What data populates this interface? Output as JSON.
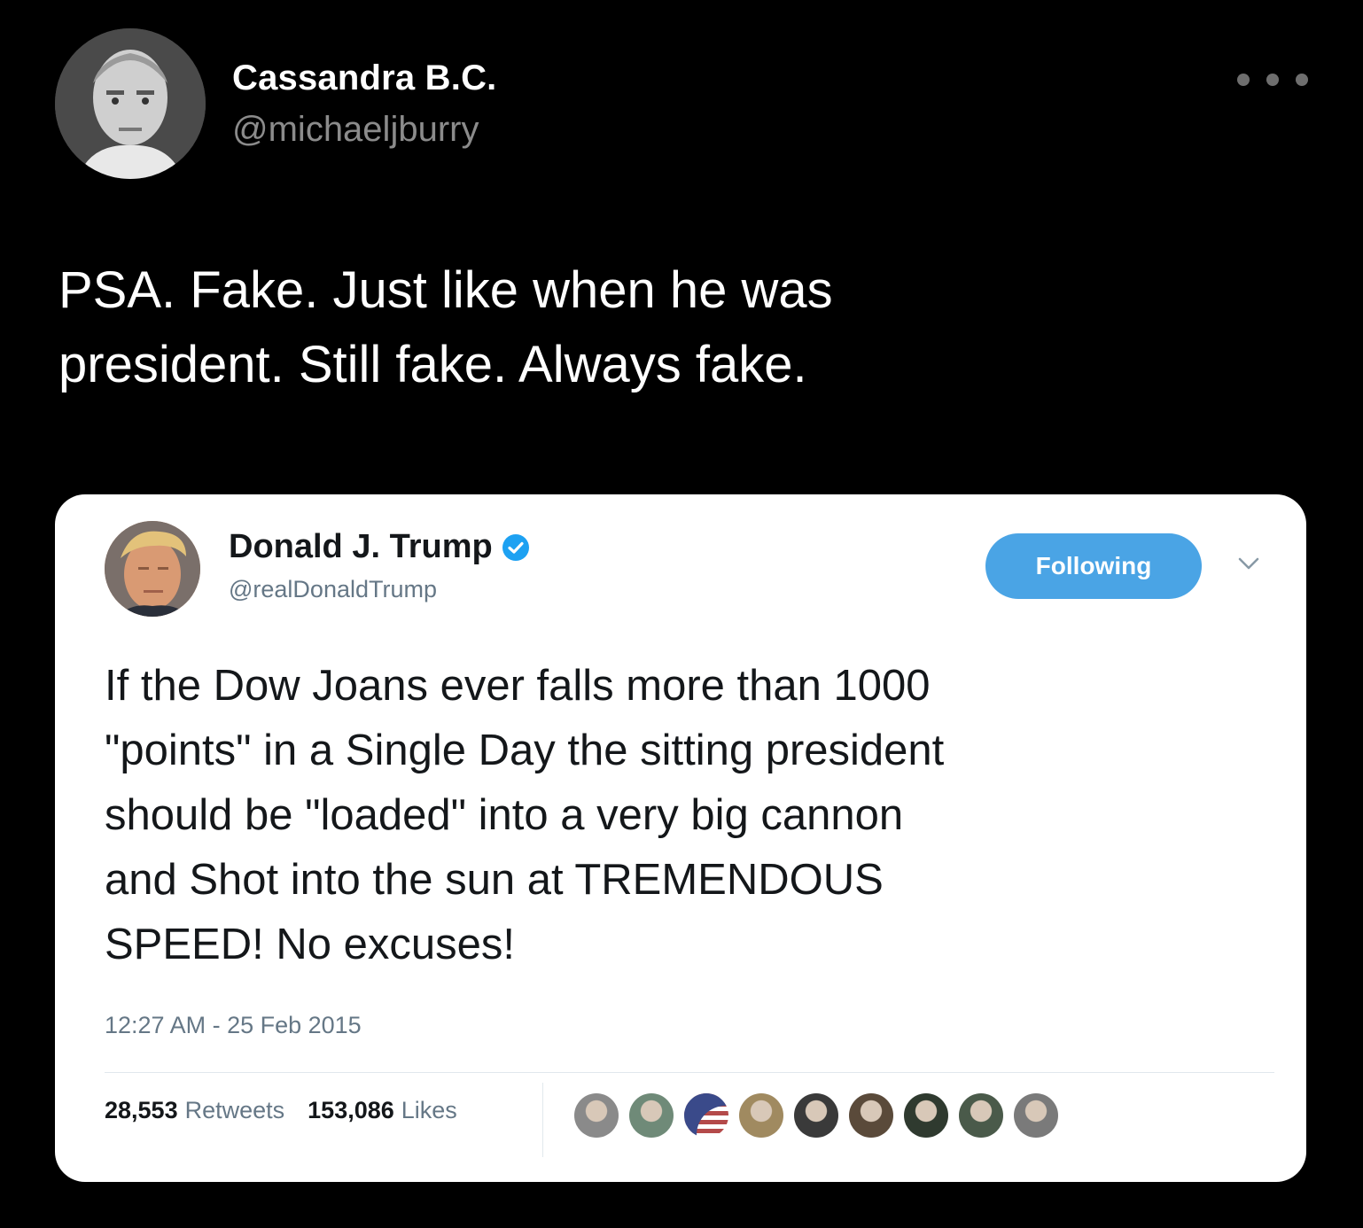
{
  "outer_tweet": {
    "display_name": "Cassandra B.C.",
    "handle": "@michaeljburry",
    "text_lines": [
      "PSA. Fake. Just like when he was",
      "president. Still fake. Always fake."
    ],
    "avatar_icon": "profile-photo-grayscale",
    "more_icon": "more-horizontal-icon"
  },
  "embedded_tweet": {
    "display_name": "Donald J. Trump",
    "handle": "@realDonaldTrump",
    "verified": true,
    "verified_color": "#1da1f2",
    "follow_button_label": "Following",
    "follow_button_color": "#4aa4e5",
    "text_lines": [
      "If the Dow Joans ever falls more than 1000",
      "\"points\" in a Single Day the sitting president",
      "should be \"loaded\" into a very big cannon",
      "and Shot into the sun at TREMENDOUS",
      "SPEED! No excuses!"
    ],
    "timestamp": "12:27 AM - 25 Feb 2015",
    "retweets_count": "28,553",
    "retweets_label": "Retweets",
    "likes_count": "153,086",
    "likes_label": "Likes",
    "liker_avatar_colors": [
      "#8a8a8a",
      "#6f8a78",
      "#b44a4a",
      "#a08a60",
      "#3a3a3a",
      "#5a4a3a",
      "#2f3a2f",
      "#4a5a4a",
      "#7a7a7a"
    ]
  },
  "colors": {
    "background": "#000000",
    "card_background": "#ffffff",
    "muted_text_dark": "#8b8b8b",
    "muted_text_light": "#657786"
  }
}
